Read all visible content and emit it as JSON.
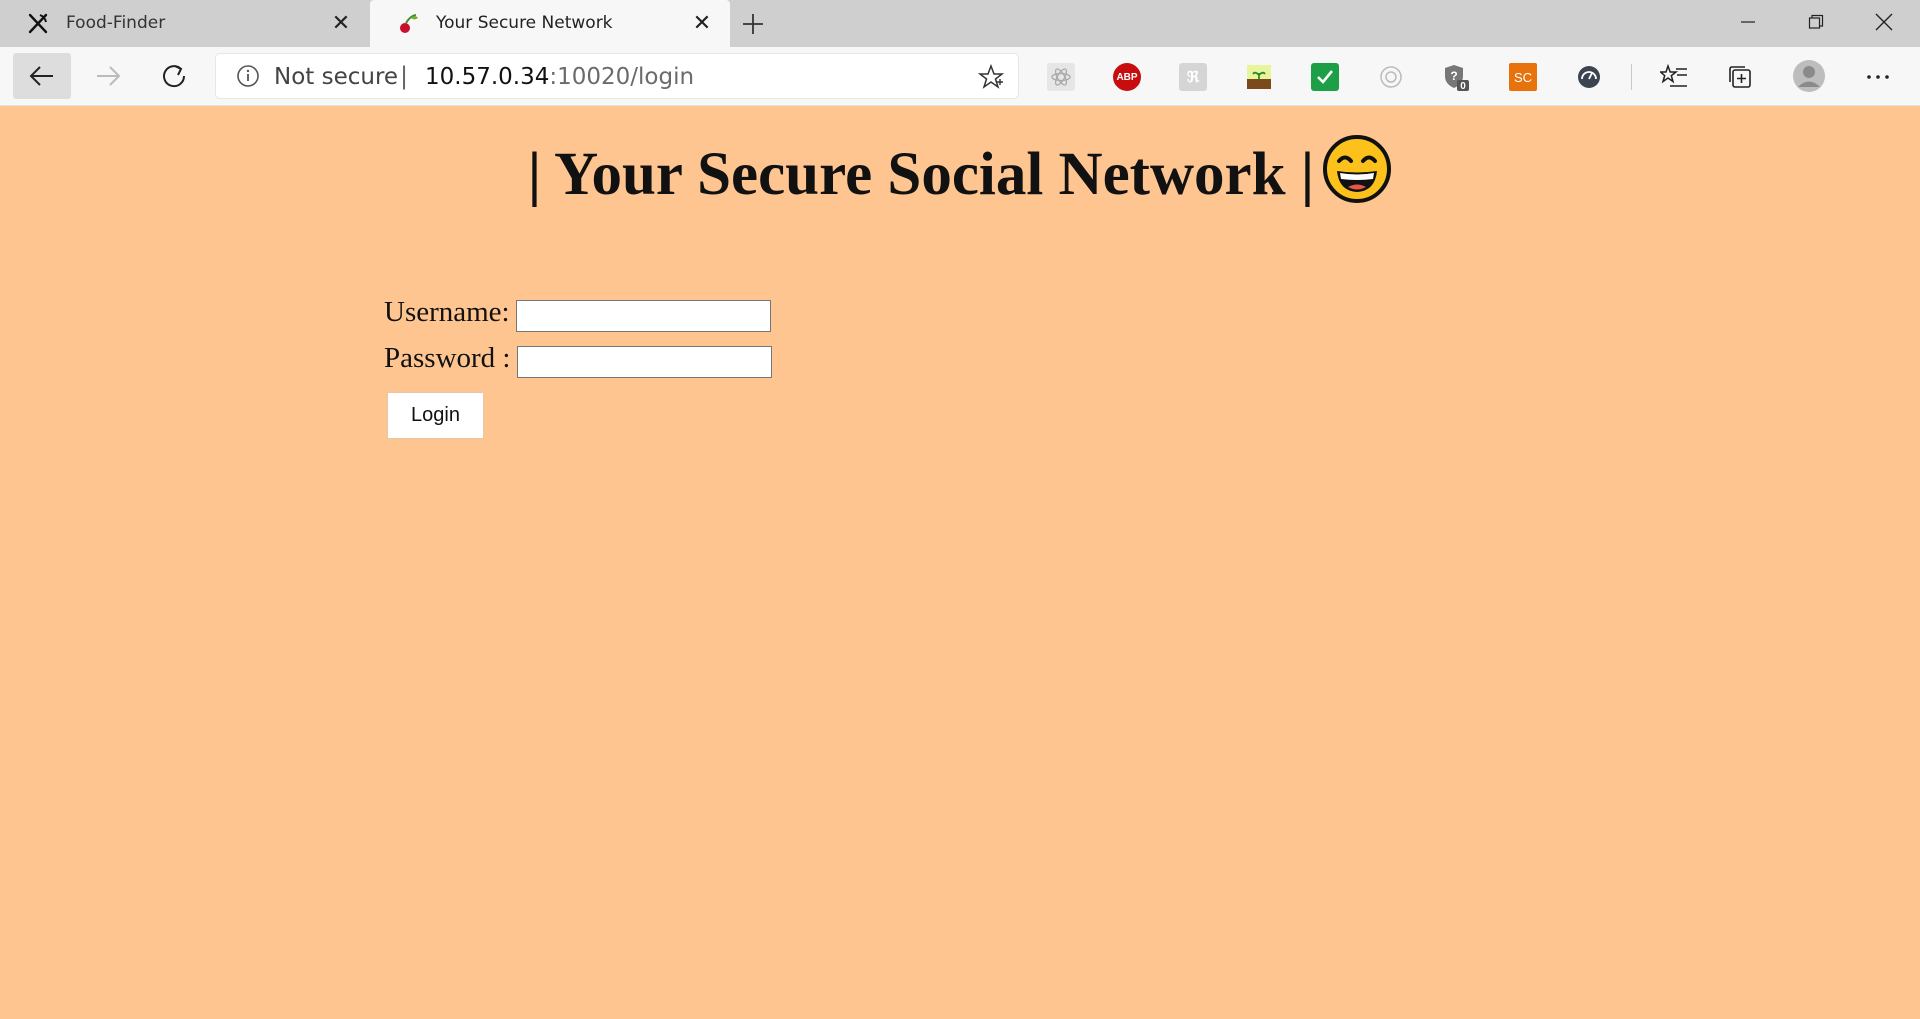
{
  "browser": {
    "tabs": [
      {
        "title": "Food-Finder",
        "active": false,
        "icon": "fork-knife-icon"
      },
      {
        "title": "Your Secure Network",
        "active": true,
        "icon": "cherry-favicon-icon"
      }
    ],
    "address_bar": {
      "security_label": "Not secure",
      "separator": "|",
      "url_host": "10.57.0.34",
      "url_path": ":10020/login"
    },
    "extensions": [
      {
        "name": "react-devtools-icon",
        "label": ""
      },
      {
        "name": "adblock-plus-icon",
        "label": "ABP"
      },
      {
        "name": "tampermonkey-icon",
        "label": ""
      },
      {
        "name": "extension-plant-icon",
        "label": ""
      },
      {
        "name": "checkmark-extension-icon",
        "label": ""
      },
      {
        "name": "extension-circle-icon",
        "label": ""
      },
      {
        "name": "privacy-badger-icon",
        "label": "0"
      },
      {
        "name": "sc-extension-icon",
        "label": "SC"
      },
      {
        "name": "speed-dial-icon",
        "label": ""
      }
    ],
    "colors": {
      "page_bg": "#fec591",
      "abp_red": "#c70d0d",
      "sc_orange": "#e8720c",
      "check_green": "#1c9f46"
    }
  },
  "page": {
    "heading": "| Your Secure Social Network |",
    "heading_emoji": "grinning-face-icon",
    "form": {
      "username_label": "Username:",
      "username_value": "",
      "password_label": "Password :",
      "password_value": "",
      "login_label": "Login"
    }
  }
}
